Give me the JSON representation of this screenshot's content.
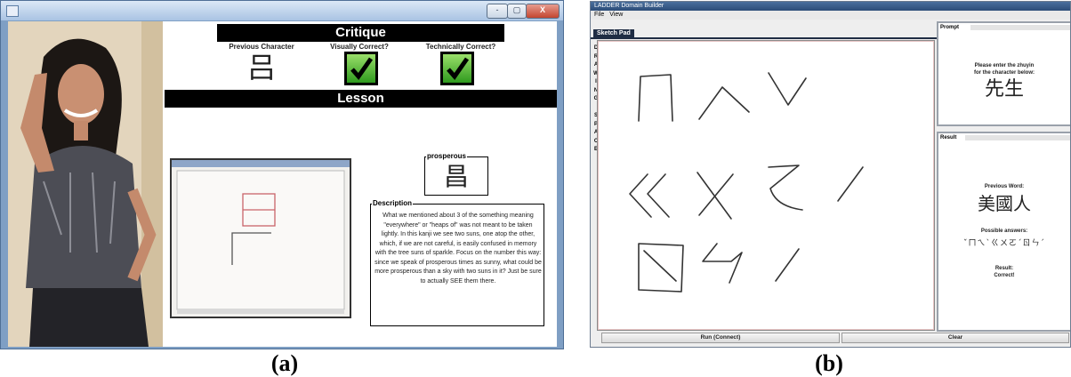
{
  "panel_a": {
    "window_buttons": [
      "-",
      "▢",
      "X"
    ],
    "critique_title": "Critique",
    "lesson_title": "Lesson",
    "columns": {
      "previous": "Previous Character",
      "visual": "Visually Correct?",
      "technical": "Technically Correct?"
    },
    "previous_char": "吕",
    "visual_check": "✓",
    "technical_check": "✓",
    "lesson_word_legend": "prosperous",
    "lesson_char": "昌",
    "description_legend": "Description",
    "description_text": "What we mentioned about 3 of the something meaning \"everywhere\" or \"heaps of\" was not meant to be taken lightly. In this kanji we see two suns, one atop the other, which, if we are not careful, is easily confused in memory with the tree suns of sparkle. Focus on the number this way: since we speak of prosperous times as sunny, what could be more prosperous than a sky with two suns in it? Just be sure to actually SEE them there."
  },
  "panel_b": {
    "window_title": "LADDER Domain Builder",
    "menu": [
      "File",
      "View"
    ],
    "tab_label": "Sketch Pad",
    "vertical_label": [
      "D",
      "R",
      "A",
      "W",
      "I",
      "N",
      "G",
      "",
      "S",
      "P",
      "A",
      "C",
      "E"
    ],
    "prompt_tab": "Prompt",
    "prompt_text_1": "Please enter the zhuyin",
    "prompt_text_2": "for the character below:",
    "prompt_chars": "先生",
    "result_tab": "Result",
    "previous_word_label": "Previous Word:",
    "previous_word": "美國人",
    "possible_answers_label": "Possible answers:",
    "possible_answers": "ˇㄇㄟˋㄍㄨㄛˊㄖㄣˊ",
    "result_label": "Result:",
    "result_value": "Correct!",
    "run_button": "Run (Connect)",
    "clear_button": "Clear"
  },
  "captions": {
    "a": "(a)",
    "b": "(b)"
  }
}
